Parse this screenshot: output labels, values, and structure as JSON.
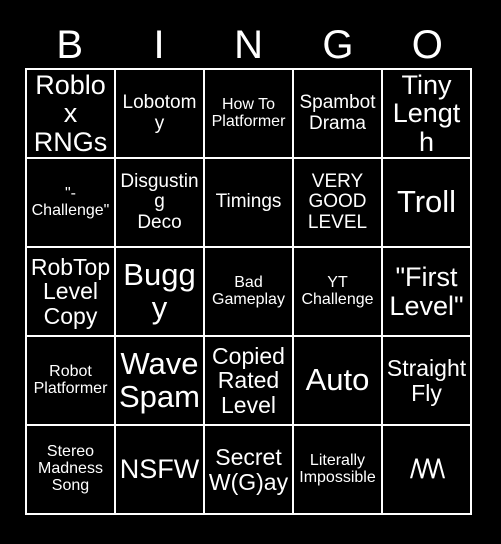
{
  "card": {
    "title": "BINGO",
    "background_color": "#000000",
    "text_color": "#ffffff",
    "grid_line_color": "#ffffff",
    "rows": 5,
    "columns": 5
  },
  "header": {
    "letters": [
      "B",
      "I",
      "N",
      "G",
      "O"
    ]
  },
  "grid": {
    "cells": [
      {
        "row": 1,
        "col": 1,
        "text": "Roblox\nRNGs",
        "size": "xl"
      },
      {
        "row": 1,
        "col": 2,
        "text": "Lobotomy",
        "size": "m"
      },
      {
        "row": 1,
        "col": 3,
        "text": "How To\nPlatformer",
        "size": "s"
      },
      {
        "row": 1,
        "col": 4,
        "text": "Spambot\nDrama",
        "size": "m"
      },
      {
        "row": 1,
        "col": 5,
        "text": "Tiny\nLength",
        "size": "xl"
      },
      {
        "row": 2,
        "col": 1,
        "text": "\"-\nChallenge\"",
        "size": "s"
      },
      {
        "row": 2,
        "col": 2,
        "text": "Disgusting\nDeco",
        "size": "m"
      },
      {
        "row": 2,
        "col": 3,
        "text": "Timings",
        "size": "m"
      },
      {
        "row": 2,
        "col": 4,
        "text": "VERY\nGOOD\nLEVEL",
        "size": "m"
      },
      {
        "row": 2,
        "col": 5,
        "text": "Troll",
        "size": "xxl"
      },
      {
        "row": 3,
        "col": 1,
        "text": "RobTop\nLevel\nCopy",
        "size": "l"
      },
      {
        "row": 3,
        "col": 2,
        "text": "Buggy",
        "size": "xxl"
      },
      {
        "row": 3,
        "col": 3,
        "text": "Bad\nGameplay",
        "size": "s"
      },
      {
        "row": 3,
        "col": 4,
        "text": "YT\nChallenge",
        "size": "s"
      },
      {
        "row": 3,
        "col": 5,
        "text": "\"First\nLevel\"",
        "size": "xl"
      },
      {
        "row": 4,
        "col": 1,
        "text": "Robot\nPlatformer",
        "size": "s"
      },
      {
        "row": 4,
        "col": 2,
        "text": "Wave\nSpam",
        "size": "xxl"
      },
      {
        "row": 4,
        "col": 3,
        "text": "Copied\nRated\nLevel",
        "size": "l"
      },
      {
        "row": 4,
        "col": 4,
        "text": "Auto",
        "size": "xxl"
      },
      {
        "row": 4,
        "col": 5,
        "text": "Straight\nFly",
        "size": "l"
      },
      {
        "row": 5,
        "col": 1,
        "text": "Stereo\nMadness\nSong",
        "size": "s"
      },
      {
        "row": 5,
        "col": 2,
        "text": "NSFW",
        "size": "xl"
      },
      {
        "row": 5,
        "col": 3,
        "text": "Secret\nW(G)ay",
        "size": "l"
      },
      {
        "row": 5,
        "col": 4,
        "text": "Literally\nImpossible",
        "size": "s"
      },
      {
        "row": 5,
        "col": 5,
        "text": "/\\/\\/\\",
        "size": "zigzag"
      }
    ]
  }
}
